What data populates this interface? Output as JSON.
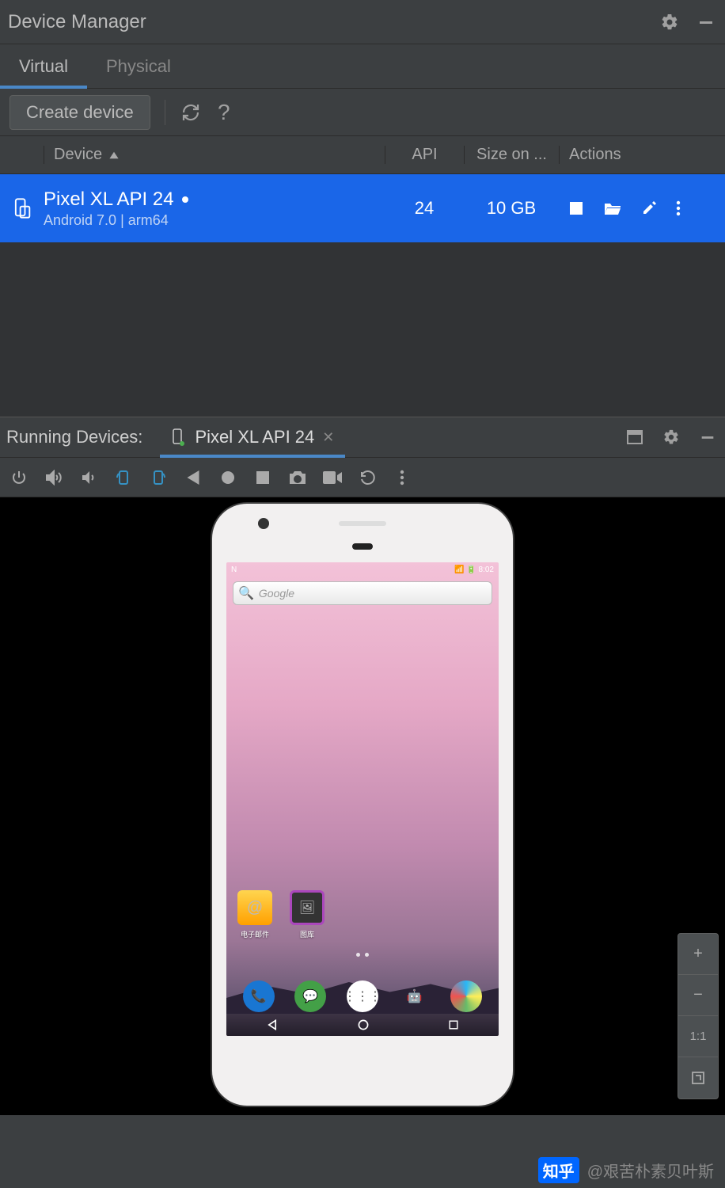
{
  "panel": {
    "title": "Device Manager"
  },
  "tabs": {
    "virtual": "Virtual",
    "physical": "Physical"
  },
  "toolbar": {
    "create": "Create device"
  },
  "table": {
    "headers": {
      "device": "Device",
      "api": "API",
      "size": "Size on ...",
      "actions": "Actions"
    },
    "row": {
      "name": "Pixel XL API 24",
      "sub": "Android 7.0 | arm64",
      "api": "24",
      "size": "10 GB"
    }
  },
  "running": {
    "label": "Running Devices:",
    "tab": "Pixel XL API 24"
  },
  "phone": {
    "status_time": "8:02",
    "search_placeholder": "Google",
    "apps": {
      "email": "电子邮件",
      "gallery": "图库"
    }
  },
  "zoom": {
    "plus": "+",
    "minus": "−",
    "fit": "1:1"
  },
  "watermark": {
    "brand": "知乎",
    "author": "@艰苦朴素贝叶斯"
  }
}
